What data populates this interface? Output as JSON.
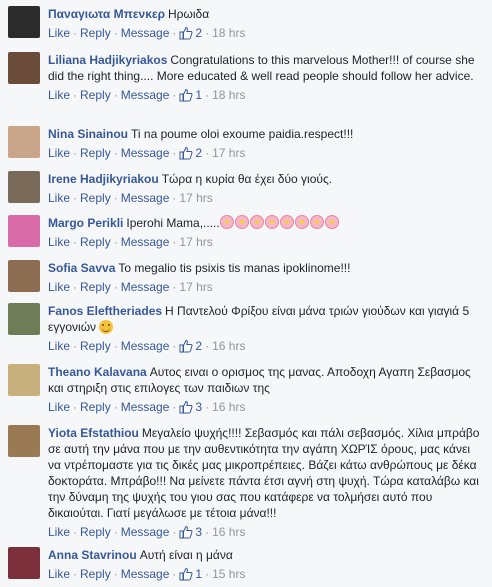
{
  "labels": {
    "like": "Like",
    "reply": "Reply",
    "message": "Message",
    "dot": "·"
  },
  "comments": [
    {
      "author": "Παναγιωτα Μπενκερ",
      "text": "Ηρωιδα",
      "likes": "2",
      "time": "18 hrs"
    },
    {
      "author": "Liliana Hadjikyriakos",
      "text": "Congratulations to this marvelous Mother!!! of course she did the right thing.... More educated & well read people should follow her advice.",
      "likes": "1",
      "time": "18 hrs"
    },
    {
      "author": "Nina Sinainou",
      "text": "Ti na poume oloi exoume paidia.respect!!!",
      "likes": "2",
      "time": "17 hrs"
    },
    {
      "author": "Irene Hadjikyriakou",
      "text": "Τώρα η κυρία θα έχει δύο γιούς.",
      "likes": "",
      "time": "17 hrs"
    },
    {
      "author": "Margo Perikli",
      "text": "Iperohi Mama,.....",
      "likes": "",
      "time": "17 hrs"
    },
    {
      "author": "Sofia Savva",
      "text": "To megalio tis psixis tis manas ipoklinome!!!",
      "likes": "",
      "time": "17 hrs"
    },
    {
      "author": "Fanos Eleftheriades",
      "text": "Η Παντελού Φρίξου είναι μάνα τριών γιούδων και γιαγιά 5 εγγονιών",
      "likes": "2",
      "time": "16 hrs"
    },
    {
      "author": "Theano Kalavana",
      "text": "Αυτος ειναι ο ορισμος της μανας. Αποδοχη Αγαπη Σεβασμος και στηριξη στις επιλογες των παιδιων της",
      "likes": "3",
      "time": "16 hrs"
    },
    {
      "author": "Yiota Efstathiou",
      "text": "Μεγαλείο ψυχής!!!! Σεβασμός και πάλι σεβασμός. Χίλια μπράβο σε αυτή την μάνα που με την αυθεντικότητα την αγάπη ΧΩΡΊΣ όρους, μας κάνει να ντρέπομαστε για τις δικές μας μικροπρέπειες. Βάζει κάτω ανθρώπους με δέκα δοκτοράτα. Μπράβο!!! Να μείνετε πάντα έτσι αγνή στη ψυχή. Τώρα καταλάβω και την δύναμη της ψυχής του γιου σας που κατάφερε να τολμήσει αυτό που δικαιούται. Γιατί μεγάλωσε με τέτοια μάνα!!!",
      "likes": "3",
      "time": "16 hrs"
    },
    {
      "author": "Anna Stavrinou",
      "text": "Αυτή είναι η μάνα",
      "likes": "1",
      "time": "15 hrs"
    }
  ],
  "avatar_colors": [
    "#2b2b2b",
    "#6b4c3b",
    "#c9a58a",
    "#7a6a5a",
    "#d86aa8",
    "#8c6d52",
    "#6e7d55",
    "#c8b07c",
    "#9a7a55",
    "#7a2f3b"
  ]
}
